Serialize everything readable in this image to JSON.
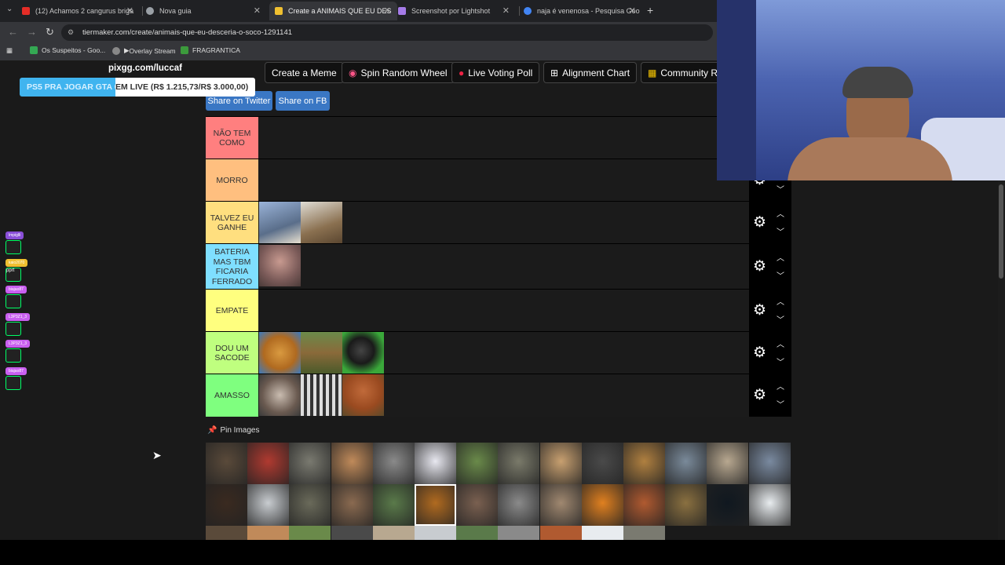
{
  "browser": {
    "tabs": [
      {
        "title": "(12) Achamos 2 cangurus briga",
        "favicon_color": "#e52d27",
        "active": false
      },
      {
        "title": "Nova guia",
        "favicon_color": "#9aa0a6",
        "active": false
      },
      {
        "title": "Create a ANIMAIS QUE EU DES",
        "favicon_color": "#f0c030",
        "active": true
      },
      {
        "title": "Screenshot por Lightshot",
        "favicon_color": "#a57be8",
        "active": false
      },
      {
        "title": "naja é venenosa - Pesquisa Goo",
        "favicon_color": "#4285f4",
        "active": false
      }
    ],
    "url": "tiermaker.com/create/animais-que-eu-desceria-o-soco-1291141",
    "bookmarks": [
      "Os Suspeitos - Goo...",
      "Overlay Stream",
      "FRAGRANTICA"
    ]
  },
  "top_buttons": [
    "Create a Meme",
    "Spin Random Wheel",
    "Live Voting Poll",
    "Alignment Chart",
    "Community Ra"
  ],
  "share": {
    "twitter": "Share on Twitter",
    "fb": "Share on FB"
  },
  "tiers": [
    {
      "label": "NÃO TEM COMO",
      "color": "#ff7f7f",
      "items": []
    },
    {
      "label": "MORRO",
      "color": "#ffbf7f",
      "items": []
    },
    {
      "label": "TALVEZ EU GANHE",
      "color": "#ffdf7f",
      "items": [
        "eagle",
        "moose"
      ]
    },
    {
      "label": "BATERIA MAS TBM FICARIA FERRADO",
      "color": "#7fdfff",
      "items": [
        "chimpanzee"
      ]
    },
    {
      "label": "EMPATE",
      "color": "#ffff7f",
      "items": []
    },
    {
      "label": "DOU UM SACODE",
      "color": "#bfff7f",
      "items": [
        "orangutan",
        "deer",
        "snake"
      ]
    },
    {
      "label": "AMASSO",
      "color": "#7fff7f",
      "items": [
        "ostrich",
        "zebra",
        "termite-mound"
      ]
    }
  ],
  "pin_images_label": "Pin Images",
  "pin_images": [
    "bison",
    "buffalo",
    "elephant",
    "caracal",
    "seal",
    "goose",
    "cheetah-cub",
    "raccoon",
    "giraffe",
    "gorilla",
    "leopard",
    "harpy-eagle",
    "hyena",
    "hippo",
    "rottweiler",
    "husky",
    "warthog",
    "beaver",
    "crocodile",
    "lion",
    "kangaroo",
    "wolf",
    "meerkat",
    "tamarin",
    "orangutan",
    "jaguar",
    "black-panther",
    "swan"
  ],
  "overlay": {
    "pix_link": "pixgg.com/luccaf",
    "donation_left": "PS5 PRA JOGAR GTA 6",
    "donation_right": "EM LIVE (R$ 1.215,73/R$ 3.000,00)",
    "chat": [
      {
        "user": "lmpiglli",
        "color": "#8a4fd8",
        "msg": ""
      },
      {
        "user": "kaio2070",
        "color": "#f0c030",
        "msg": "pprt"
      },
      {
        "user": "biajao87",
        "color": "#c95ff0",
        "msg": ""
      },
      {
        "user": "L3P3Z1_3",
        "color": "#c95ff0",
        "msg": ""
      },
      {
        "user": "L3P3Z1_3",
        "color": "#c95ff0",
        "msg": ""
      },
      {
        "user": "biajao87",
        "color": "#c95ff0",
        "msg": ""
      }
    ]
  }
}
